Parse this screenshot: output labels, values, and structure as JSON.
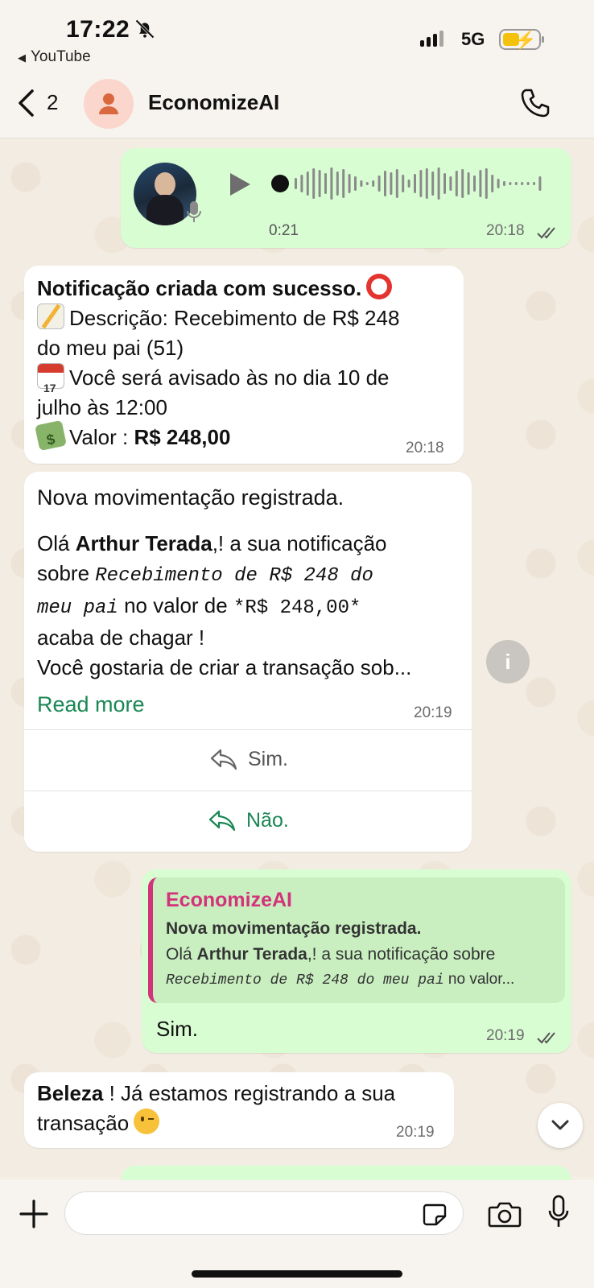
{
  "status_bar": {
    "time": "17:22",
    "back_app": "YouTube",
    "network": "5G",
    "battery_color": "#f4c20d"
  },
  "header": {
    "back_count": "2",
    "contact_name": "EconomizeAI",
    "avatar_bg": "#fad6cc",
    "icons": [
      "chevron-left-icon",
      "person-icon",
      "phone-icon"
    ]
  },
  "messages": {
    "voice": {
      "duration": "0:21",
      "time": "20:18"
    },
    "notification": {
      "title": "Notificação criada com sucesso.",
      "line1": "Descrição: Recebimento de R$ 248",
      "line2": "do meu pai (51)",
      "line3": "Você será avisado às no dia 10 de",
      "line4": "julho às 12:00",
      "value_label": "Valor :",
      "value_amount": "R$ 248,00",
      "time": "20:18"
    },
    "movement": {
      "title": "Nova movimentação registrada.",
      "greet_prefix": "Olá",
      "greet_name": "Arthur Terada",
      "greet_suffix": ",!  a sua  notificação",
      "about_prefix": "sobre",
      "about_mono1": "Recebimento de R$ 248 do",
      "about_mono2": "meu pai",
      "value_prefix": "no valor de",
      "value_mono": "*R$ 248,00*",
      "line_arrive": "acaba de chagar !",
      "line_question": "Você gostaria de criar a transação sob...",
      "read_more": "Read more",
      "time": "20:19",
      "reply_yes": "Sim.",
      "reply_no": "Não."
    },
    "reply": {
      "quote_author": "EconomizeAI",
      "quote_title": "Nova movimentação registrada.",
      "quote_greet_prefix": "Olá",
      "quote_greet_name": "Arthur Terada",
      "quote_greet_suffix": ",!  a sua  notificação sobre",
      "quote_mono": "Recebimento de R$ 248 do meu pai",
      "quote_tail": " no valor...",
      "text": "Sim.",
      "time": "20:19"
    },
    "confirm": {
      "bold": "Beleza",
      "line1": " ! Já estamos registrando a sua",
      "line2": "transação",
      "time": "20:19"
    }
  },
  "colors": {
    "incoming_bubble": "#ffffff",
    "outgoing_bubble": "#d9fdd3",
    "link_green": "#1a8754",
    "quote_author": "#d2337a"
  }
}
